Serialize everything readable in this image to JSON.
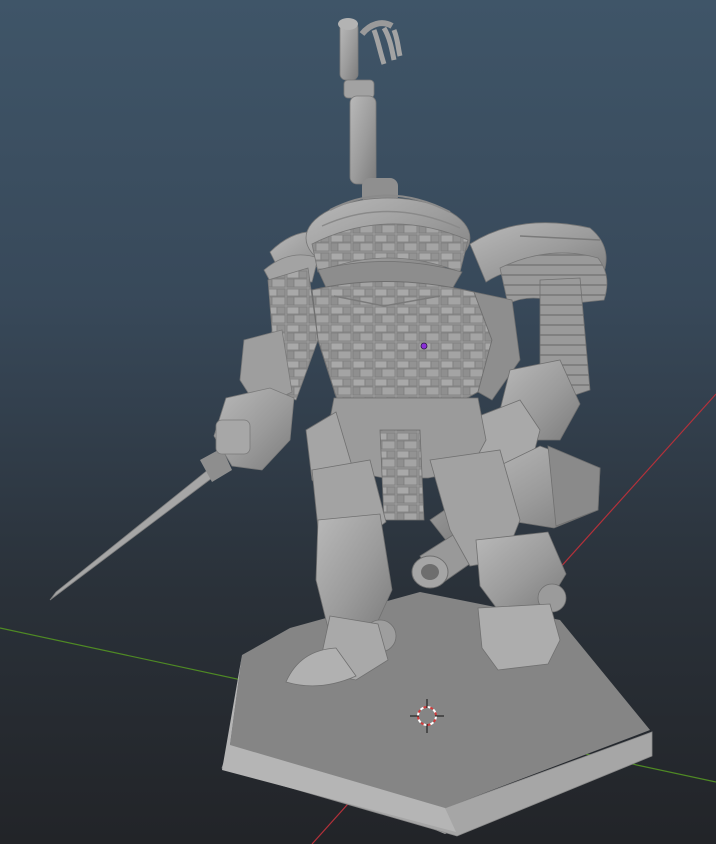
{
  "viewport": {
    "kind": "3d-viewport",
    "background_top": "#3f5568",
    "background_bottom": "#222428",
    "x_axis_color": "#b4313a",
    "y_axis_color": "#4f8a24",
    "model_color": "#9a9a9a",
    "origin_marker_color": "#8a2fd8"
  },
  "icons": {
    "cursor": "3d-cursor-icon",
    "origin": "object-origin-icon"
  }
}
